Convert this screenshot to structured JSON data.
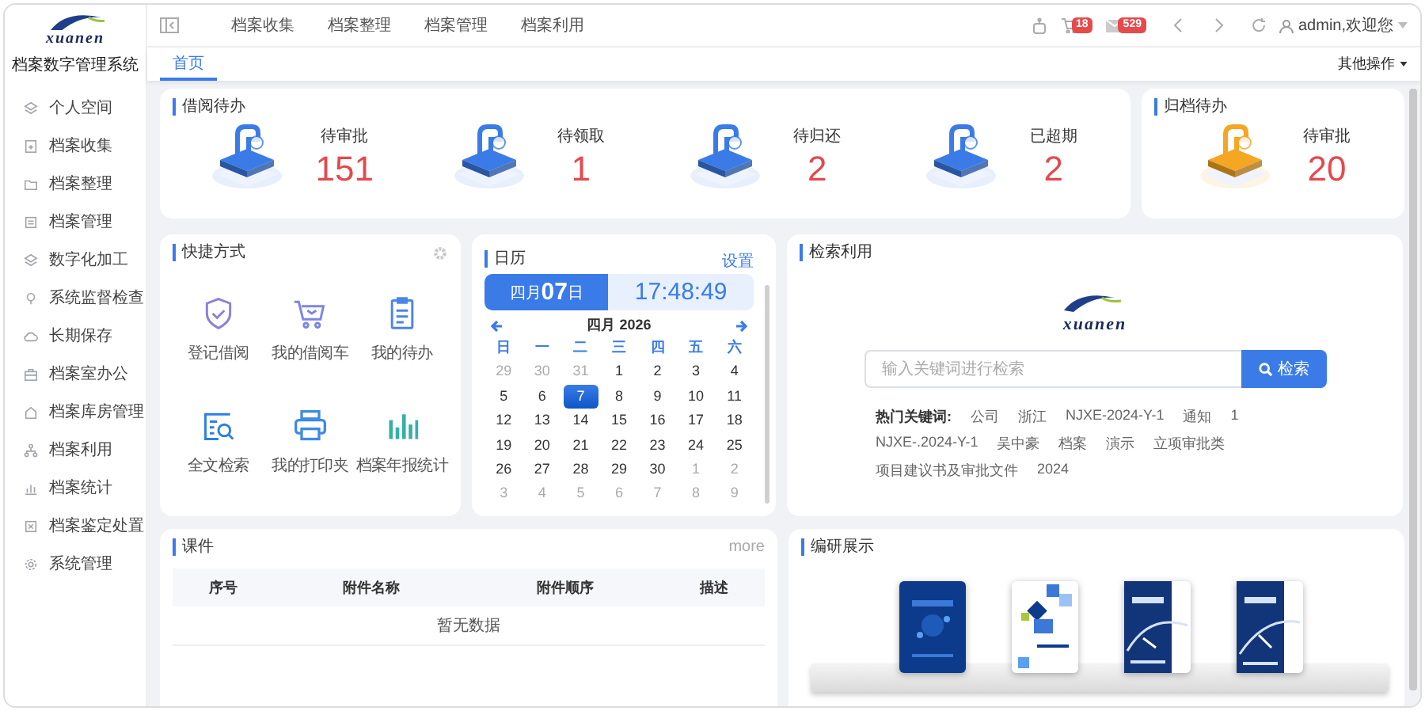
{
  "sidebar": {
    "logo": "xuanen",
    "title": "档案数字管理系统",
    "items": [
      {
        "label": "个人空间",
        "kind": "layers"
      },
      {
        "label": "档案收集",
        "kind": "doc-plus"
      },
      {
        "label": "档案整理",
        "kind": "folder"
      },
      {
        "label": "档案管理",
        "kind": "list"
      },
      {
        "label": "数字化加工",
        "kind": "layers"
      },
      {
        "label": "系统监督检查",
        "kind": "pin"
      },
      {
        "label": "长期保存",
        "kind": "cloud"
      },
      {
        "label": "档案室办公",
        "kind": "briefcase"
      },
      {
        "label": "档案库房管理",
        "kind": "home"
      },
      {
        "label": "档案利用",
        "kind": "tree"
      },
      {
        "label": "档案统计",
        "kind": "chart"
      },
      {
        "label": "档案鉴定处置",
        "kind": "box-x"
      },
      {
        "label": "系统管理",
        "kind": "gear"
      }
    ]
  },
  "top_nav": {
    "items": [
      "档案收集",
      "档案整理",
      "档案管理",
      "档案利用"
    ]
  },
  "toolbar": {
    "cart_count": "18",
    "mail_count": "529",
    "user": "admin,欢迎您"
  },
  "tabs": [
    {
      "label": "首页",
      "selected": true
    }
  ],
  "other_actions": "其他操作",
  "borrow_todo": {
    "title": "借阅待办",
    "stats": [
      {
        "label": "待审批",
        "value": "151",
        "color": "#3a7be8"
      },
      {
        "label": "待领取",
        "value": "1",
        "color": "#3a7be8"
      },
      {
        "label": "待归还",
        "value": "2",
        "color": "#3a7be8"
      },
      {
        "label": "已超期",
        "value": "2",
        "color": "#3a7be8"
      }
    ]
  },
  "archive_todo": {
    "title": "归档待办",
    "stats": [
      {
        "label": "待审批",
        "value": "20",
        "color": "#f5a623"
      }
    ]
  },
  "shortcuts": {
    "title": "快捷方式",
    "items": [
      {
        "label": "登记借阅",
        "kind": "shield"
      },
      {
        "label": "我的借阅车",
        "kind": "cart"
      },
      {
        "label": "我的待办",
        "kind": "clipboard"
      },
      {
        "label": "全文检索",
        "kind": "search-doc"
      },
      {
        "label": "我的打印夹",
        "kind": "printer"
      },
      {
        "label": "档案年报统计",
        "kind": "chart"
      }
    ]
  },
  "calendar": {
    "title": "日历",
    "settings_link": "设置",
    "date": "四月**07**日",
    "time": "17:48:49",
    "month_label": "四月 2026",
    "weekdays": [
      "日",
      "一",
      "二",
      "三",
      "四",
      "五",
      "六"
    ],
    "days": [
      {
        "text": "29",
        "other_month": true,
        "selected": false
      },
      {
        "text": "30",
        "other_month": true,
        "selected": false
      },
      {
        "text": "31",
        "other_month": true,
        "selected": false
      },
      {
        "text": "1",
        "other_month": false,
        "selected": false
      },
      {
        "text": "2",
        "other_month": false,
        "selected": false
      },
      {
        "text": "3",
        "other_month": false,
        "selected": false
      },
      {
        "text": "4",
        "other_month": false,
        "selected": false
      },
      {
        "text": "5",
        "other_month": false,
        "selected": false
      },
      {
        "text": "6",
        "other_month": false,
        "selected": false
      },
      {
        "text": "7",
        "other_month": false,
        "selected": true
      },
      {
        "text": "8",
        "other_month": false,
        "selected": false
      },
      {
        "text": "9",
        "other_month": false,
        "selected": false
      },
      {
        "text": "10",
        "other_month": false,
        "selected": false
      },
      {
        "text": "11",
        "other_month": false,
        "selected": false
      },
      {
        "text": "12",
        "other_month": false,
        "selected": false
      },
      {
        "text": "13",
        "other_month": false,
        "selected": false
      },
      {
        "text": "14",
        "other_month": false,
        "selected": false
      },
      {
        "text": "15",
        "other_month": false,
        "selected": false
      },
      {
        "text": "16",
        "other_month": false,
        "selected": false
      },
      {
        "text": "17",
        "other_month": false,
        "selected": false
      },
      {
        "text": "18",
        "other_month": false,
        "selected": false
      },
      {
        "text": "19",
        "other_month": false,
        "selected": false
      },
      {
        "text": "20",
        "other_month": false,
        "selected": false
      },
      {
        "text": "21",
        "other_month": false,
        "selected": false
      },
      {
        "text": "22",
        "other_month": false,
        "selected": false
      },
      {
        "text": "23",
        "other_month": false,
        "selected": false
      },
      {
        "text": "24",
        "other_month": false,
        "selected": false
      },
      {
        "text": "25",
        "other_month": false,
        "selected": false
      },
      {
        "text": "26",
        "other_month": false,
        "selected": false
      },
      {
        "text": "27",
        "other_month": false,
        "selected": false
      },
      {
        "text": "28",
        "other_month": false,
        "selected": false
      },
      {
        "text": "29",
        "other_month": false,
        "selected": false
      },
      {
        "text": "30",
        "other_month": false,
        "selected": false
      },
      {
        "text": "1",
        "other_month": true,
        "selected": false
      },
      {
        "text": "2",
        "other_month": true,
        "selected": false
      },
      {
        "text": "3",
        "other_month": true,
        "selected": false
      },
      {
        "text": "4",
        "other_month": true,
        "selected": false
      },
      {
        "text": "5",
        "other_month": true,
        "selected": false
      },
      {
        "text": "6",
        "other_month": true,
        "selected": false
      },
      {
        "text": "7",
        "other_month": true,
        "selected": false
      },
      {
        "text": "8",
        "other_month": true,
        "selected": false
      },
      {
        "text": "9",
        "other_month": true,
        "selected": false
      }
    ]
  },
  "search": {
    "title": "检索利用",
    "logo": "xuanen",
    "placeholder": "输入关键词进行检索",
    "button": "检索",
    "hot_label": "热门关键词:",
    "keywords": [
      "公司",
      "浙江",
      "NJXE-2024-Y-1",
      "通知",
      "1",
      "NJXE-.2024-Y-1",
      "吴中豪",
      "档案",
      "演示",
      "立项审批类",
      "项目建议书及审批文件",
      "2024"
    ]
  },
  "courseware": {
    "title": "课件",
    "more": "more",
    "columns": [
      "序号",
      "附件名称",
      "附件顺序",
      "描述"
    ],
    "empty": "暂无数据"
  },
  "showcase": {
    "title": "编研展示"
  }
}
